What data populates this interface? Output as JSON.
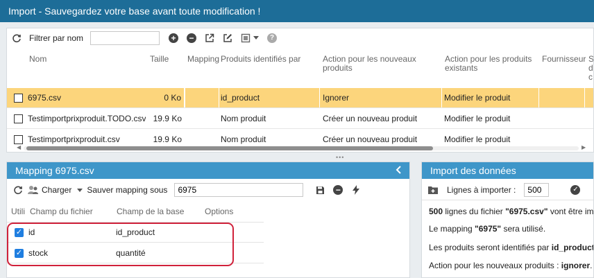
{
  "window": {
    "title": "Import - Sauvegardez votre base avant toute modification !"
  },
  "files_toolbar": {
    "filter_label": "Filtrer par nom",
    "filter_value": "",
    "help_label": "?"
  },
  "files_grid": {
    "columns": [
      "Nom",
      "Taille",
      "Mapping",
      "Produits identifiés par",
      "Action pour les nouveaux produits",
      "Action pour les produits existants",
      "Fournisseur",
      "S d c"
    ],
    "rows": [
      {
        "name": "6975.csv",
        "size": "0 Ko",
        "mapping": "",
        "identified_by": "id_product",
        "new_action": "Ignorer",
        "existing_action": "Modifier le produit",
        "selected": true
      },
      {
        "name": "Testimportprixproduit.TODO.csv",
        "size": "19.9 Ko",
        "mapping": "",
        "identified_by": "Nom produit",
        "new_action": "Créer un nouveau produit",
        "existing_action": "Modifier le produit",
        "selected": false
      },
      {
        "name": "Testimportprixproduit.csv",
        "size": "19.9 Ko",
        "mapping": "",
        "identified_by": "Nom produit",
        "new_action": "Créer un nouveau produit",
        "existing_action": "Modifier le produit",
        "selected": false
      }
    ]
  },
  "mapping_panel": {
    "title": "Mapping 6975.csv",
    "load_label": "Charger",
    "save_label": "Sauver mapping sous",
    "mapping_name": "6975",
    "columns": [
      "Utili",
      "Champ du fichier",
      "Champ de la base",
      "Options"
    ],
    "rows": [
      {
        "file_field": "id",
        "db_field": "id_product",
        "used": true
      },
      {
        "file_field": "stock",
        "db_field": "quantité",
        "used": true
      }
    ]
  },
  "import_panel": {
    "title": "Import des données",
    "lines_label": "Lignes à importer :",
    "lines_value": "500",
    "info": {
      "line1": {
        "count": "500",
        "mid": " lignes du fichier ",
        "file": "\"6975.csv\"",
        "end": " vont être impo"
      },
      "line2": {
        "start": "Le mapping ",
        "name": "\"6975\"",
        "end": " sera utilisé."
      },
      "line3": {
        "start": "Les produits seront identifiés par ",
        "key": "id_product",
        "end": "."
      },
      "line4": {
        "start": "Action pour les nouveaux produits : ",
        "action": "ignorer",
        "end": "."
      }
    }
  },
  "colors": {
    "titlebar": "#1d6d98",
    "panel_header": "#3e96c9",
    "selected_row": "#fcd57c",
    "highlight": "#d0213a",
    "checkbox": "#1f7ee0"
  }
}
